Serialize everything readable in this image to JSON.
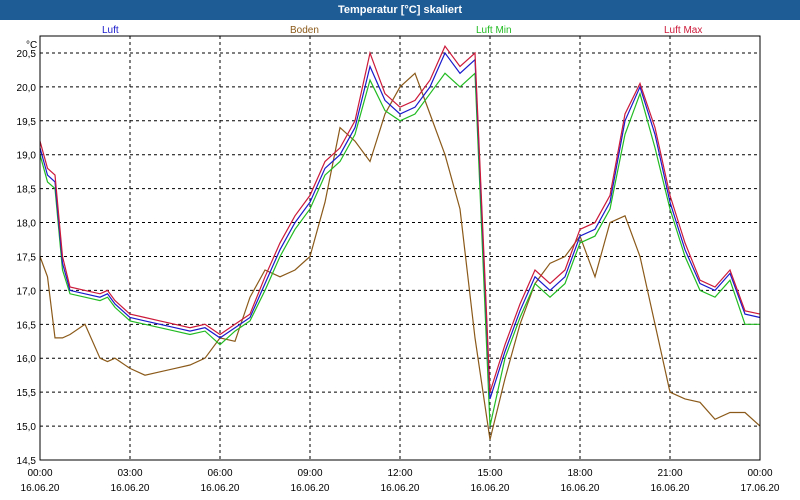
{
  "window": {
    "title": "Temperatur [°C] skaliert"
  },
  "chart_data": {
    "type": "line",
    "title": "Temperatur [°C] skaliert",
    "ylabel": "°C",
    "ylim": [
      14.5,
      20.75
    ],
    "yticks": [
      "14,5",
      "15,0",
      "15,5",
      "16,0",
      "16,5",
      "17,0",
      "17,5",
      "18,0",
      "18,5",
      "19,0",
      "19,5",
      "20,0",
      "20,5"
    ],
    "x_ticks": [
      {
        "time": "00:00",
        "date": "16.06.20"
      },
      {
        "time": "03:00",
        "date": "16.06.20"
      },
      {
        "time": "06:00",
        "date": "16.06.20"
      },
      {
        "time": "09:00",
        "date": "16.06.20"
      },
      {
        "time": "12:00",
        "date": "16.06.20"
      },
      {
        "time": "15:00",
        "date": "16.06.20"
      },
      {
        "time": "18:00",
        "date": "16.06.20"
      },
      {
        "time": "21:00",
        "date": "16.06.20"
      },
      {
        "time": "00:00",
        "date": "17.06.20"
      }
    ],
    "x_hours": [
      0,
      0.25,
      0.5,
      0.75,
      1,
      1.5,
      2,
      2.25,
      2.5,
      3,
      3.5,
      4,
      4.5,
      5,
      5.5,
      6,
      6.5,
      7,
      7.5,
      8,
      8.5,
      9,
      9.5,
      10,
      10.5,
      11,
      11.5,
      12,
      12.5,
      13,
      13.5,
      14,
      14.5,
      15,
      15.5,
      16,
      16.5,
      17,
      17.5,
      18,
      18.5,
      19,
      19.5,
      20,
      20.5,
      21,
      21.5,
      22,
      22.5,
      23,
      23.5,
      24
    ],
    "grid": true,
    "legend_position": "top",
    "series": [
      {
        "name": "Luft",
        "color": "#1a1acc",
        "values": [
          19.1,
          18.7,
          18.6,
          17.4,
          17.0,
          16.95,
          16.9,
          16.95,
          16.8,
          16.6,
          16.55,
          16.5,
          16.45,
          16.4,
          16.45,
          16.3,
          16.45,
          16.6,
          17.1,
          17.6,
          18.0,
          18.3,
          18.8,
          19.0,
          19.4,
          20.3,
          19.8,
          19.6,
          19.7,
          20.0,
          20.5,
          20.2,
          20.4,
          15.4,
          16.1,
          16.7,
          17.2,
          17.0,
          17.2,
          17.8,
          17.9,
          18.3,
          19.5,
          20.0,
          19.3,
          18.3,
          17.6,
          17.1,
          17.0,
          17.25,
          16.65,
          16.6
        ]
      },
      {
        "name": "Boden",
        "color": "#8b5a1a",
        "values": [
          17.5,
          17.2,
          16.3,
          16.3,
          16.35,
          16.5,
          16.0,
          15.95,
          16.0,
          15.85,
          15.75,
          15.8,
          15.85,
          15.9,
          16.0,
          16.3,
          16.25,
          16.9,
          17.3,
          17.2,
          17.3,
          17.5,
          18.3,
          19.4,
          19.2,
          18.9,
          19.6,
          20.0,
          20.2,
          19.6,
          19.0,
          18.2,
          16.3,
          14.8,
          15.7,
          16.5,
          17.1,
          17.4,
          17.5,
          17.8,
          17.2,
          18.0,
          18.1,
          17.5,
          16.5,
          15.5,
          15.4,
          15.35,
          15.1,
          15.2,
          15.2,
          15.0
        ]
      },
      {
        "name": "Luft Min",
        "color": "#22bb22",
        "values": [
          19.0,
          18.6,
          18.5,
          17.3,
          16.95,
          16.9,
          16.85,
          16.9,
          16.75,
          16.55,
          16.5,
          16.45,
          16.4,
          16.35,
          16.4,
          16.2,
          16.4,
          16.55,
          17.0,
          17.5,
          17.9,
          18.2,
          18.7,
          18.9,
          19.3,
          20.1,
          19.65,
          19.5,
          19.6,
          19.9,
          20.2,
          20.0,
          20.2,
          15.0,
          16.0,
          16.6,
          17.1,
          16.9,
          17.1,
          17.7,
          17.8,
          18.2,
          19.3,
          19.9,
          19.1,
          18.2,
          17.5,
          17.0,
          16.9,
          17.15,
          16.5,
          16.5
        ]
      },
      {
        "name": "Luft Max",
        "color": "#cc1a3a",
        "values": [
          19.2,
          18.8,
          18.7,
          17.5,
          17.05,
          17.0,
          16.95,
          17.0,
          16.85,
          16.65,
          16.6,
          16.55,
          16.5,
          16.45,
          16.5,
          16.35,
          16.5,
          16.65,
          17.2,
          17.7,
          18.1,
          18.4,
          18.9,
          19.1,
          19.5,
          20.5,
          19.9,
          19.7,
          19.8,
          20.1,
          20.6,
          20.3,
          20.5,
          15.5,
          16.2,
          16.8,
          17.3,
          17.1,
          17.3,
          17.9,
          18.0,
          18.4,
          19.6,
          20.05,
          19.4,
          18.4,
          17.7,
          17.15,
          17.05,
          17.3,
          16.7,
          16.65
        ]
      }
    ]
  }
}
